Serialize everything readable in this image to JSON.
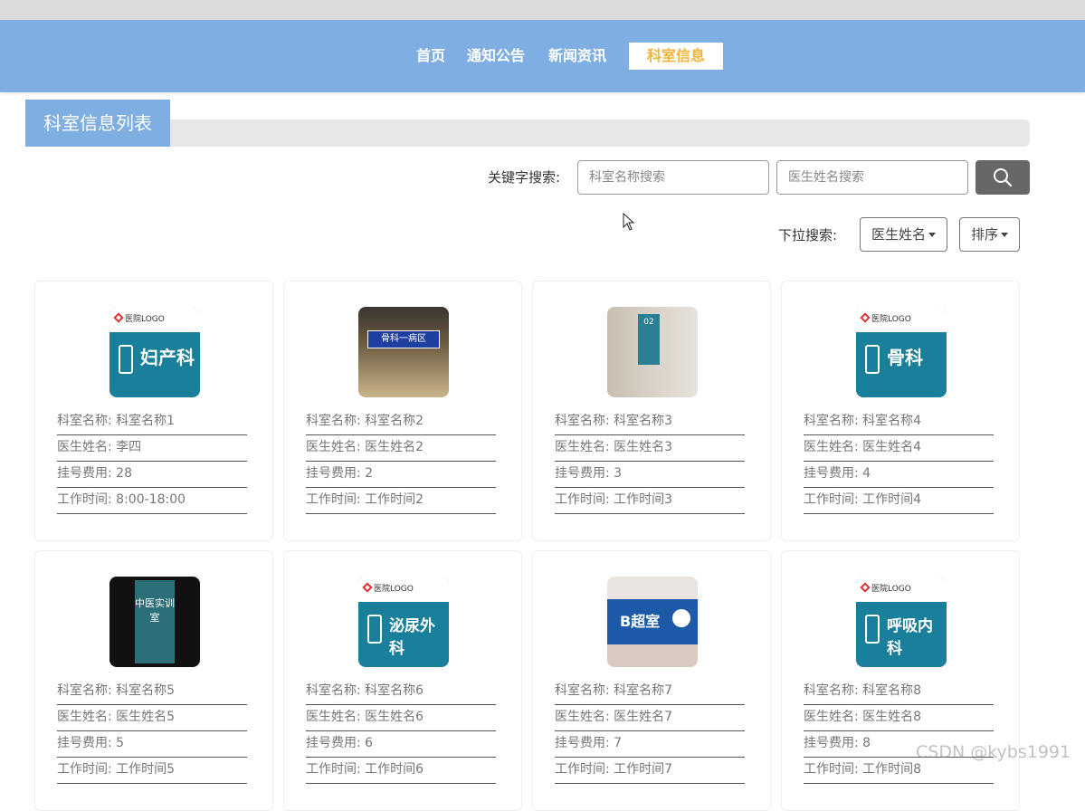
{
  "nav": {
    "items": [
      "首页",
      "通知公告",
      "新闻资讯",
      "科室信息"
    ],
    "active_index": 3
  },
  "section": {
    "title": "科室信息列表"
  },
  "search": {
    "label": "关键字搜索:",
    "dept_placeholder": "科室名称搜索",
    "doctor_placeholder": "医生姓名搜索"
  },
  "dropdown": {
    "label": "下拉搜索:",
    "field_select": "医生姓名",
    "sort_select": "排序"
  },
  "cards": [
    {
      "dept_label": "科室名称:",
      "dept": "科室名称1",
      "doctor_label": "医生姓名:",
      "doctor": "李四",
      "fee_label": "挂号费用:",
      "fee": "28",
      "time_label": "工作时间:",
      "time": "8:00-18:00",
      "image": "妇产科"
    },
    {
      "dept_label": "科室名称:",
      "dept": "科室名称2",
      "doctor_label": "医生姓名:",
      "doctor": "医生姓名2",
      "fee_label": "挂号费用:",
      "fee": "2",
      "time_label": "工作时间:",
      "time": "工作时间2",
      "image": "骨科一病区"
    },
    {
      "dept_label": "科室名称:",
      "dept": "科室名称3",
      "doctor_label": "医生姓名:",
      "doctor": "医生姓名3",
      "fee_label": "挂号费用:",
      "fee": "3",
      "time_label": "工作时间:",
      "time": "工作时间3",
      "image": "02"
    },
    {
      "dept_label": "科室名称:",
      "dept": "科室名称4",
      "doctor_label": "医生姓名:",
      "doctor": "医生姓名4",
      "fee_label": "挂号费用:",
      "fee": "4",
      "time_label": "工作时间:",
      "time": "工作时间4",
      "image": "骨科"
    },
    {
      "dept_label": "科室名称:",
      "dept": "科室名称5",
      "doctor_label": "医生姓名:",
      "doctor": "医生姓名5",
      "fee_label": "挂号费用:",
      "fee": "5",
      "time_label": "工作时间:",
      "time": "工作时间5",
      "image": "中医实训室"
    },
    {
      "dept_label": "科室名称:",
      "dept": "科室名称6",
      "doctor_label": "医生姓名:",
      "doctor": "医生姓名6",
      "fee_label": "挂号费用:",
      "fee": "6",
      "time_label": "工作时间:",
      "time": "工作时间6",
      "image": "泌尿外科"
    },
    {
      "dept_label": "科室名称:",
      "dept": "科室名称7",
      "doctor_label": "医生姓名:",
      "doctor": "医生姓名7",
      "fee_label": "挂号费用:",
      "fee": "7",
      "time_label": "工作时间:",
      "time": "工作时间7",
      "image": "B超室"
    },
    {
      "dept_label": "科室名称:",
      "dept": "科室名称8",
      "doctor_label": "医生姓名:",
      "doctor": "医生姓名8",
      "fee_label": "挂号费用:",
      "fee": "8",
      "time_label": "工作时间:",
      "time": "工作时间8",
      "image": "呼吸内科"
    }
  ],
  "sign_logo": "医院LOGO",
  "watermark": "CSDN @kybs1991",
  "colors": {
    "nav_bg": "#7faee2",
    "active_text": "#f0b43a",
    "search_btn": "#666769",
    "sign_teal": "#1a7f9a"
  }
}
